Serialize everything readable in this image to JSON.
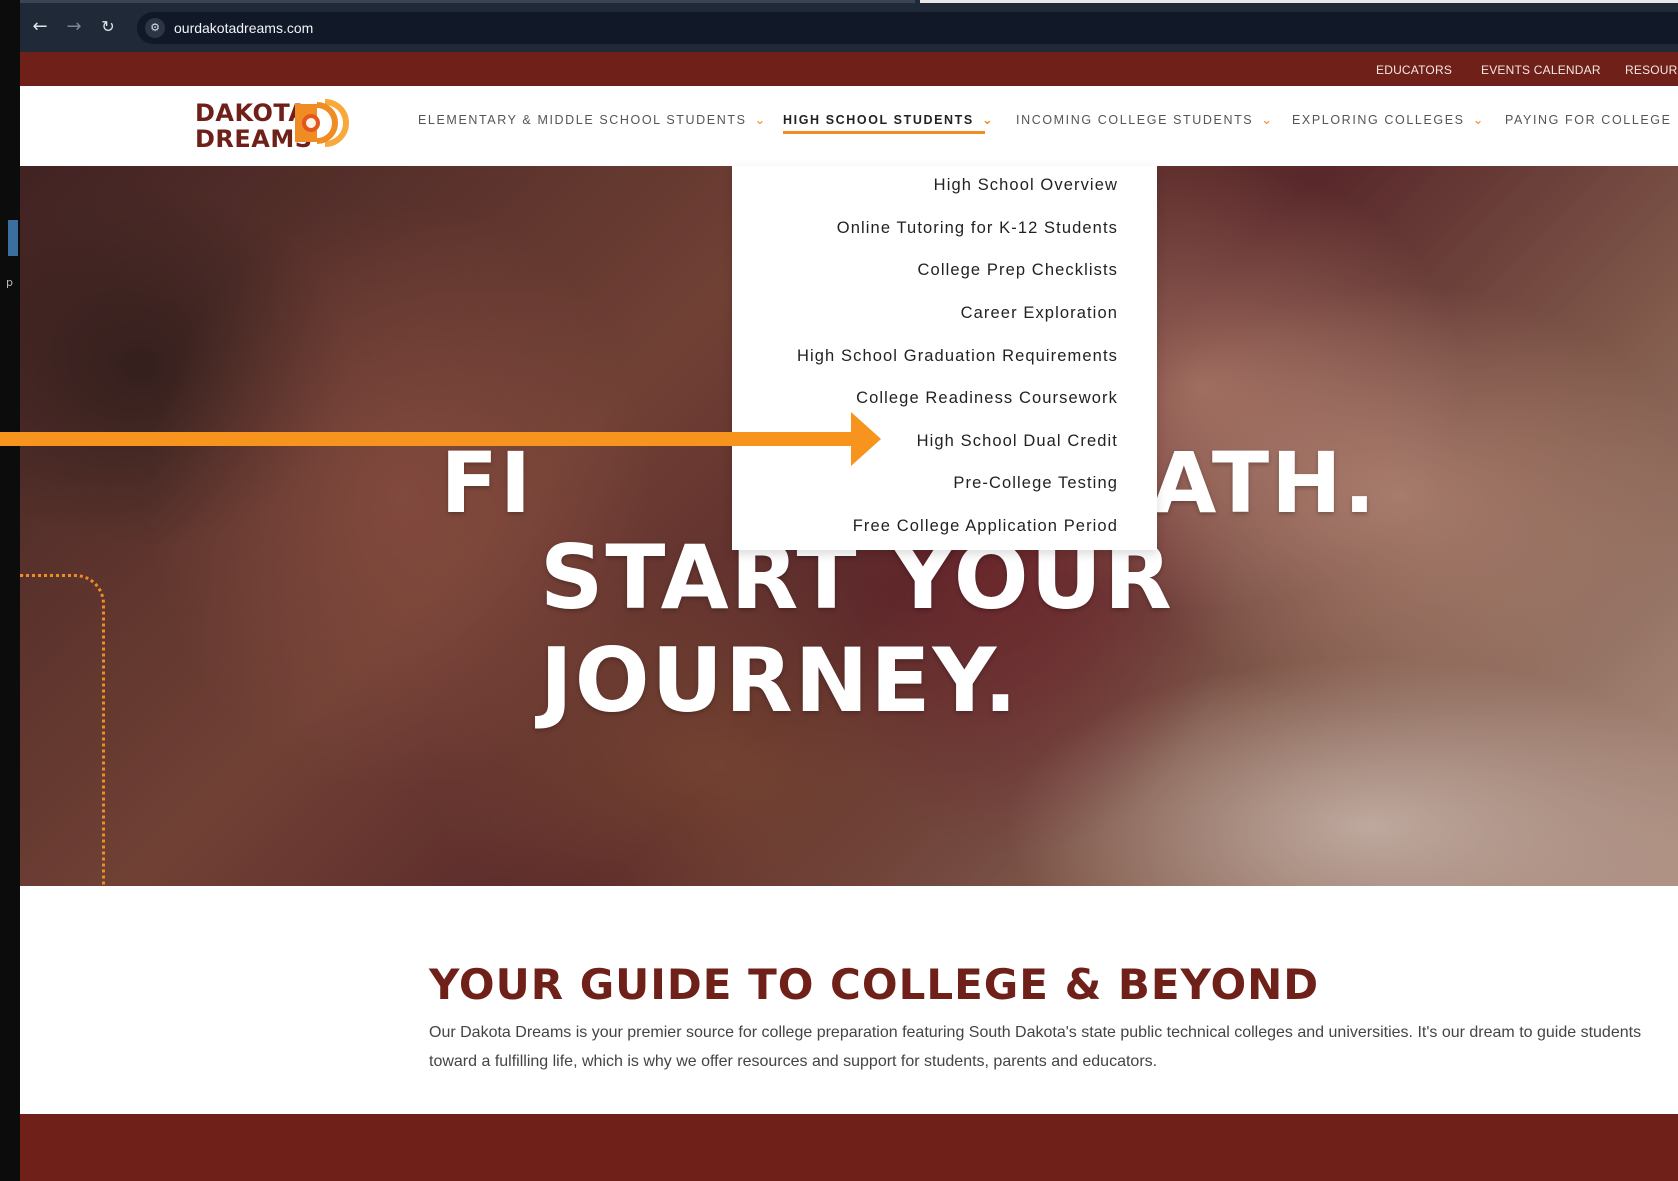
{
  "browser": {
    "url": "ourdakotadreams.com"
  },
  "utility_nav": [
    "EDUCATORS",
    "EVENTS CALENDAR",
    "RESOUR"
  ],
  "logo": {
    "line1": "DAKOTA",
    "line2": "DREAMS"
  },
  "main_nav": [
    {
      "label": "ELEMENTARY & MIDDLE SCHOOL STUDENTS",
      "chevron": "⌄"
    },
    {
      "label": "HIGH SCHOOL STUDENTS",
      "chevron": "⌄"
    },
    {
      "label": "INCOMING COLLEGE STUDENTS",
      "chevron": "⌄"
    },
    {
      "label": "EXPLORING COLLEGES",
      "chevron": "⌄"
    },
    {
      "label": "PAYING FOR COLLEGE",
      "chevron": "⌄"
    }
  ],
  "dropdown": {
    "items": [
      "High School Overview",
      "Online Tutoring for K-12 Students",
      "College Prep Checklists",
      "Career Exploration",
      "High School Graduation Requirements",
      "College Readiness Coursework",
      "High School Dual Credit",
      "Pre-College Testing",
      "Free College Application Period"
    ]
  },
  "hero": {
    "line1": "FI                  PATH.",
    "line2": "START YOUR JOURNEY."
  },
  "intro": {
    "title": "YOUR GUIDE TO COLLEGE & BEYOND",
    "body": "Our Dakota Dreams is your premier source for college preparation featuring South Dakota's state public technical colleges and universities. It's our dream to guide students toward a fulfilling life, which is why we offer resources and support for students, parents and educators."
  },
  "colors": {
    "brand_maroon": "#6e2019",
    "brand_orange": "#f08c24",
    "annotation_arrow": "#f7941d"
  },
  "icons": [
    "back-arrow-icon",
    "forward-arrow-icon",
    "reload-icon",
    "site-settings-icon",
    "chevron-down-icon",
    "logo-sun-icon",
    "arrow-annotation"
  ]
}
